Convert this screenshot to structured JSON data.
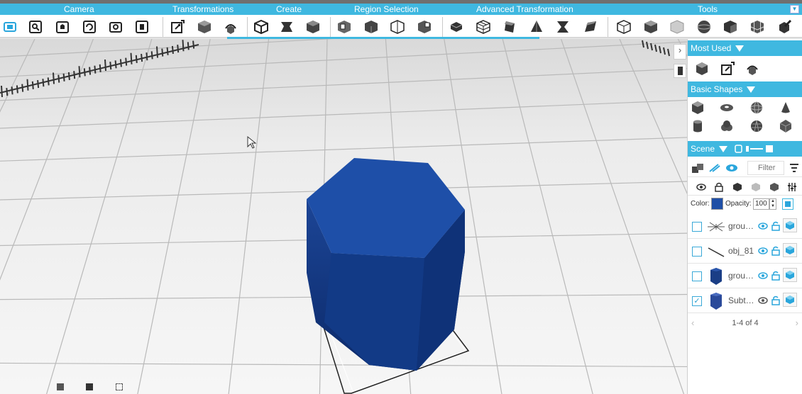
{
  "menu": {
    "camera": "Camera",
    "transformations": "Transformations",
    "create": "Create",
    "region_selection": "Region Selection",
    "advanced_transformation": "Advanced Transformation",
    "tools": "Tools"
  },
  "panel": {
    "most_used": "Most Used",
    "basic_shapes": "Basic Shapes",
    "scene": "Scene",
    "filter_placeholder": "Filter",
    "color_label": "Color:",
    "opacity_label": "Opacity:",
    "opacity_value": "100",
    "color_value": "#1f4fa6",
    "pager": "1-4 of 4"
  },
  "scene_items": [
    {
      "name": "grou…",
      "checked": false,
      "thumb": "light-icon"
    },
    {
      "name": "obj_81",
      "checked": false,
      "thumb": "line-object-icon"
    },
    {
      "name": "grou…",
      "checked": false,
      "thumb": "hexagon-prism-icon"
    },
    {
      "name": "Subt…",
      "checked": true,
      "thumb": "hexagon-prism-icon"
    }
  ],
  "colors": {
    "accent": "#3fb8e0",
    "object_top": "#1e4fa8",
    "object_side": "#153e8a"
  }
}
